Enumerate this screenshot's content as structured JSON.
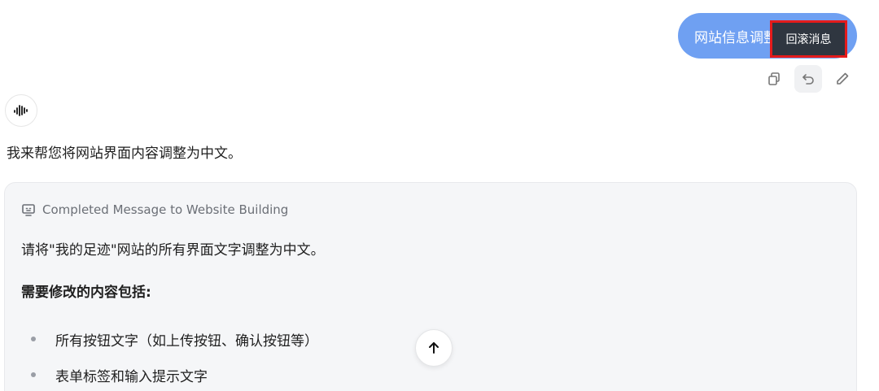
{
  "user_message": {
    "text": "网站信息调整为中文",
    "bubble_color": "#6fa0f2"
  },
  "tooltip": {
    "label": "回滚消息",
    "highlight_color": "#e51b1b"
  },
  "message_actions": [
    {
      "icon": "copy-icon"
    },
    {
      "icon": "undo-icon"
    },
    {
      "icon": "edit-icon"
    }
  ],
  "assistant": {
    "avatar_icon": "waveform-icon",
    "reply": "我来帮您将网站界面内容调整为中文。"
  },
  "card": {
    "header_icon": "monitor-icon",
    "header": "Completed Message to Website Building",
    "paragraph": "请将\"我的足迹\"网站的所有界面文字调整为中文。",
    "subheading": "需要修改的内容包括:",
    "items": [
      "所有按钮文字（如上传按钮、确认按钮等）",
      "表单标签和输入提示文字"
    ]
  },
  "scroll_top": {
    "icon": "arrow-up-icon"
  }
}
